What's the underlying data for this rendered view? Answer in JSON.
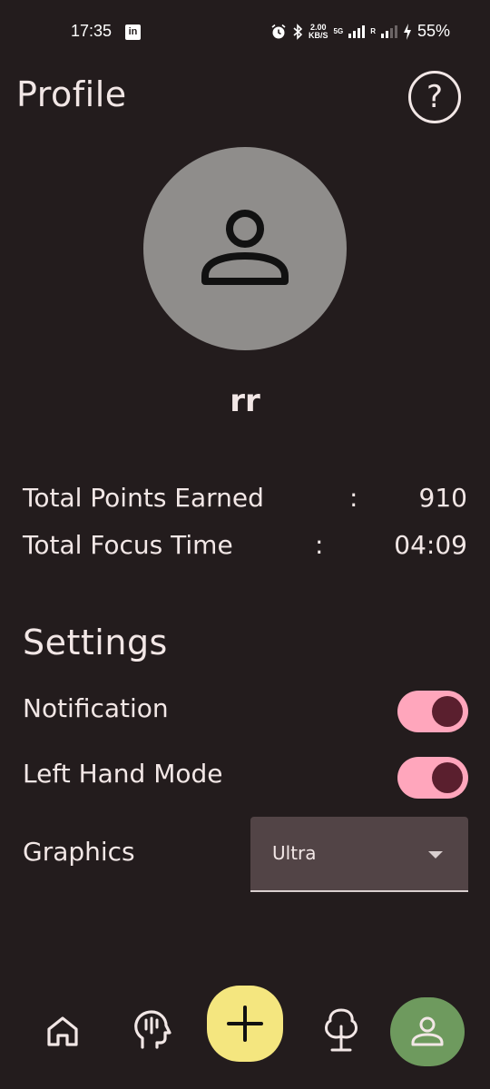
{
  "status_bar": {
    "time": "17:35",
    "linkedin_icon": "in",
    "net_speed_value": "2.00",
    "net_speed_unit": "KB/S",
    "network_type": "5G",
    "roaming_label": "R",
    "battery": "55%",
    "icons": [
      "alarm-icon",
      "bluetooth-icon",
      "signal-icon",
      "charging-icon"
    ]
  },
  "header": {
    "title": "Profile",
    "help_icon": "question-circle-icon"
  },
  "profile": {
    "avatar_icon": "person-icon",
    "username": "rr"
  },
  "stats": [
    {
      "label": "Total Points Earned",
      "separator": ":",
      "value": "910"
    },
    {
      "label": "Total Focus Time",
      "separator": ":",
      "value": "04:09"
    }
  ],
  "settings": {
    "title": "Settings",
    "notification": {
      "label": "Notification",
      "enabled": true
    },
    "left_hand_mode": {
      "label": "Left Hand Mode",
      "enabled": true
    },
    "graphics": {
      "label": "Graphics",
      "selected": "Ultra"
    }
  },
  "bottom_nav": [
    {
      "name": "home",
      "icon": "home-icon"
    },
    {
      "name": "focus",
      "icon": "head-icon"
    },
    {
      "name": "add",
      "icon": "plus-icon"
    },
    {
      "name": "tree",
      "icon": "tree-icon"
    },
    {
      "name": "profile",
      "icon": "person-icon",
      "active": true
    }
  ],
  "colors": {
    "background": "#231c1d",
    "text": "#f2e7e6",
    "avatar_bg": "#8f8d8b",
    "toggle_track": "#ffa6bc",
    "toggle_knob": "#5a1f2e",
    "dropdown_bg": "#524446",
    "add_button": "#f4e67f",
    "active_nav": "#6e9a5e"
  }
}
